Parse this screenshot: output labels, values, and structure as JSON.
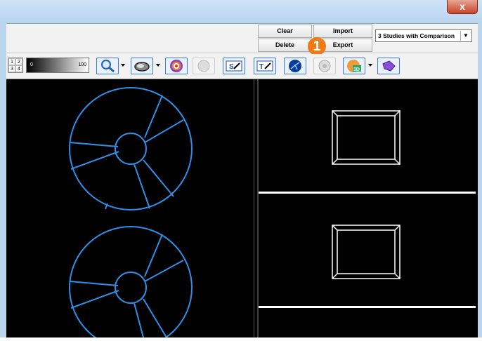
{
  "window": {
    "close_glyph": "x"
  },
  "toolbar": {
    "clear_label": "Clear",
    "import_label": "Import",
    "delete_label": "Delete",
    "export_label": "Export",
    "layout_select_value": "3 Studies with Comparison",
    "callout_number": "1"
  },
  "layout_grid": [
    "1",
    "2",
    "3",
    "4"
  ],
  "window_level": {
    "min": "0",
    "max": "100"
  },
  "tools": [
    {
      "name": "zoom-magnifier-icon",
      "has_dropdown": true
    },
    {
      "name": "pan-hand-icon",
      "has_dropdown": true
    },
    {
      "name": "polar-map-icon",
      "has_dropdown": false
    },
    {
      "name": "sphere-disabled-icon",
      "has_dropdown": false
    },
    {
      "name": "s-tool-icon",
      "has_dropdown": false
    },
    {
      "name": "text-annotation-icon",
      "has_dropdown": false
    },
    {
      "name": "vessel-overlay-icon",
      "has_dropdown": false
    },
    {
      "name": "settings-disabled-icon",
      "has_dropdown": false
    },
    {
      "name": "3d-render-icon",
      "has_dropdown": true
    },
    {
      "name": "surface-3d-icon",
      "has_dropdown": false
    }
  ],
  "colors": {
    "accent": "#3b7bd9",
    "contour": "#2f8fe8",
    "callout": "#f07b16"
  }
}
